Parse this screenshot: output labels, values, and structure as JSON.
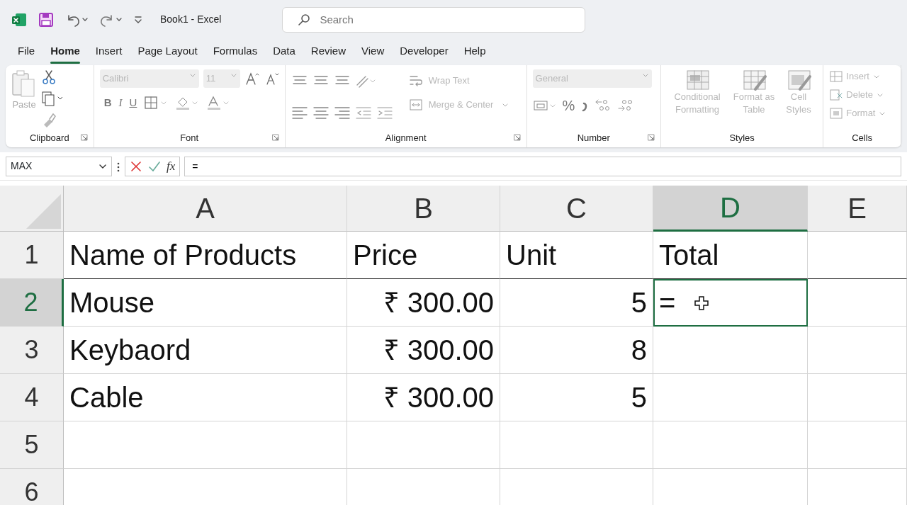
{
  "title_bar": {
    "title": "Book1  -  Excel",
    "search_placeholder": "Search"
  },
  "menu_tabs": [
    {
      "label": "File",
      "selected": false
    },
    {
      "label": "Home",
      "selected": true
    },
    {
      "label": "Insert",
      "selected": false
    },
    {
      "label": "Page Layout",
      "selected": false
    },
    {
      "label": "Formulas",
      "selected": false
    },
    {
      "label": "Data",
      "selected": false
    },
    {
      "label": "Review",
      "selected": false
    },
    {
      "label": "View",
      "selected": false
    },
    {
      "label": "Developer",
      "selected": false
    },
    {
      "label": "Help",
      "selected": false
    }
  ],
  "ribbon": {
    "clipboard": {
      "label": "Clipboard",
      "paste": {
        "label": "Paste",
        "disabled": true
      }
    },
    "font": {
      "label": "Font",
      "font_name": {
        "value": "Calibri",
        "disabled": true
      },
      "font_size": {
        "value": "11",
        "disabled": true
      },
      "format_buttons": [
        "B",
        "I",
        "U"
      ]
    },
    "alignment": {
      "label": "Alignment",
      "wrap_text": {
        "label": "Wrap Text",
        "disabled": true
      },
      "merge_center": {
        "label": "Merge & Center",
        "disabled": true
      }
    },
    "number": {
      "label": "Number",
      "format": {
        "value": "General",
        "disabled": true
      },
      "percent": "%"
    },
    "styles": {
      "label": "Styles",
      "commands": [
        {
          "label": "Conditional Formatting",
          "disabled": true
        },
        {
          "label": "Format as Table",
          "disabled": true
        },
        {
          "label": "Cell Styles",
          "disabled": true
        }
      ]
    },
    "cells": {
      "label": "Cells",
      "commands": [
        {
          "label": "Insert",
          "disabled": true
        },
        {
          "label": "Delete",
          "disabled": true
        },
        {
          "label": "Format",
          "disabled": true
        }
      ]
    }
  },
  "formula_bar": {
    "name_box": "MAX",
    "fx": "fx",
    "content": "="
  },
  "sheet": {
    "columns": [
      {
        "label": "A",
        "selected": false
      },
      {
        "label": "B",
        "selected": false
      },
      {
        "label": "C",
        "selected": false
      },
      {
        "label": "D",
        "selected": true
      },
      {
        "label": "E",
        "selected": false
      }
    ],
    "rows": [
      {
        "header": "1",
        "selected": false,
        "cells": [
          {
            "text": "Name of Products",
            "kind": "text",
            "active": false
          },
          {
            "text": "Price",
            "kind": "text",
            "active": false
          },
          {
            "text": "Unit",
            "kind": "text",
            "active": false
          },
          {
            "text": "Total",
            "kind": "text",
            "active": false
          }
        ]
      },
      {
        "header": "2",
        "selected": true,
        "cells": [
          {
            "text": "Mouse",
            "kind": "text",
            "active": false
          },
          {
            "text": "₹ 300.00",
            "kind": "number",
            "active": false
          },
          {
            "text": "5",
            "kind": "number",
            "active": false
          },
          {
            "text": "=",
            "kind": "text",
            "active": true
          }
        ]
      },
      {
        "header": "3",
        "selected": false,
        "cells": [
          {
            "text": "Keybaord",
            "kind": "text",
            "active": false
          },
          {
            "text": "₹ 300.00",
            "kind": "number",
            "active": false
          },
          {
            "text": "8",
            "kind": "number",
            "active": false
          }
        ]
      },
      {
        "header": "4",
        "selected": false,
        "cells": [
          {
            "text": "Cable",
            "kind": "text",
            "active": false
          },
          {
            "text": "₹ 300.00",
            "kind": "number",
            "active": false
          },
          {
            "text": "5",
            "kind": "number",
            "active": false
          }
        ]
      },
      {
        "header": "5",
        "selected": false,
        "cells": []
      },
      {
        "header": "6",
        "selected": false,
        "cells": []
      }
    ]
  }
}
